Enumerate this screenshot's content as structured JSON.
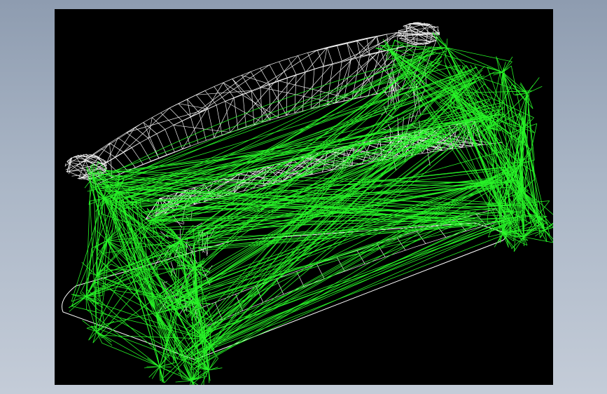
{
  "scene": {
    "background_color": "#000000",
    "page_gradient_top": "#8e9cb0",
    "page_gradient_bottom": "#c4ccd8",
    "wireframe_colors": {
      "back_cushions": "#ffffff",
      "frame": "#2aff2a",
      "base_plate": "#ffffff"
    },
    "object": "sofa-wireframe-3d-model"
  }
}
